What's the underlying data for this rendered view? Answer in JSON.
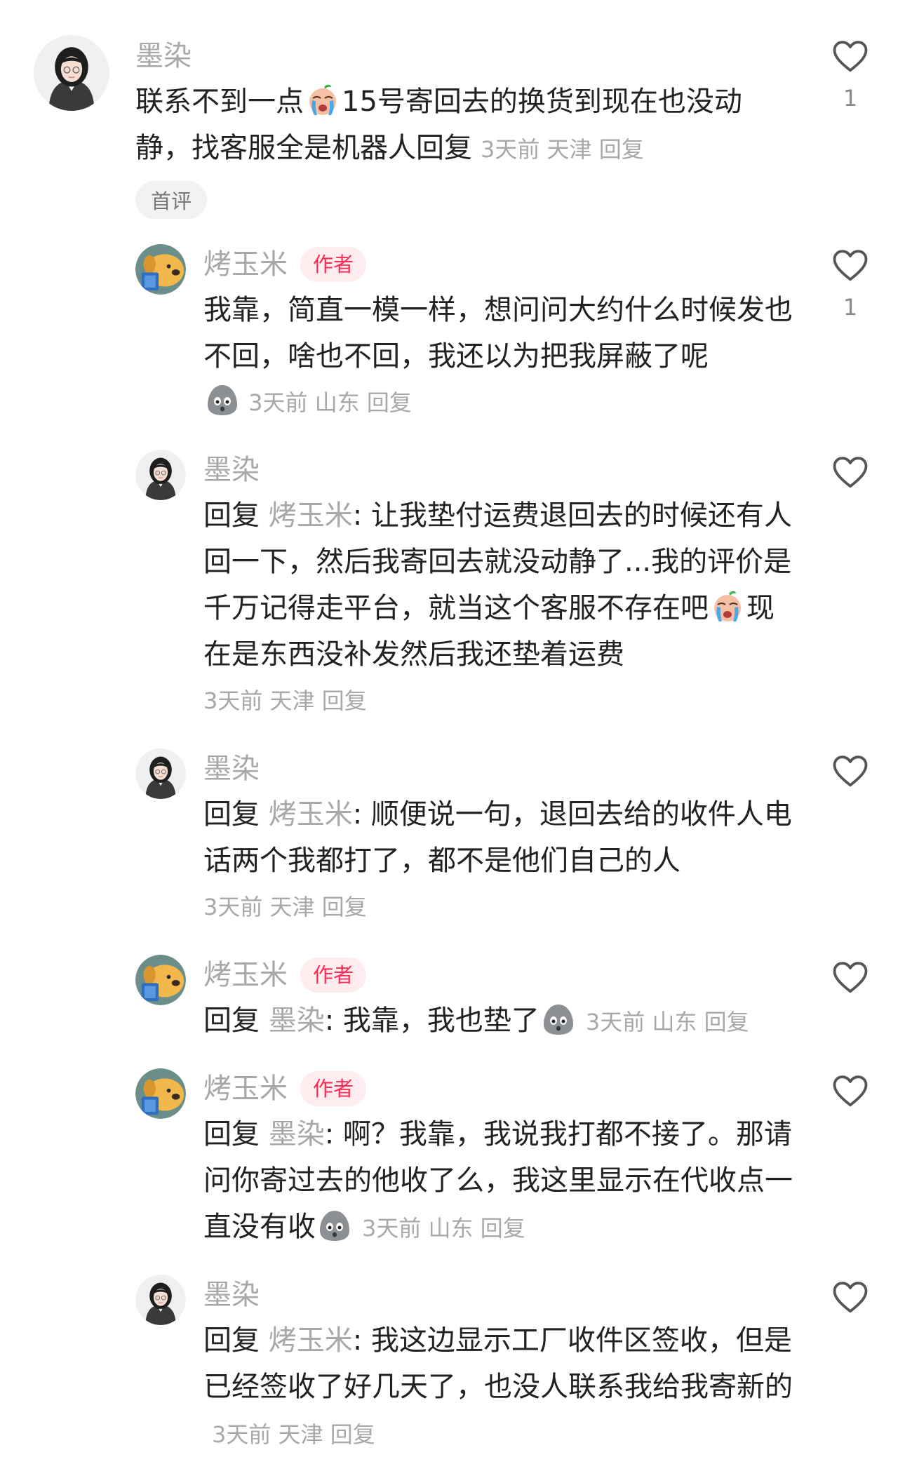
{
  "comments": [
    {
      "user": "墨染",
      "text": "联系不到一点",
      "emoji": "crying-face-emoji",
      "text_after": "15号寄回去的换货到现在也没动静，找客服全是机器人回复",
      "time": "3天前",
      "location": "天津",
      "reply_action": "回复",
      "like_count": "1",
      "tag": "首评"
    },
    {
      "user": "烤玉米",
      "badge": "作者",
      "text": "我靠，简直一模一样，想问问大约什么时候发也不回，啥也不回，我还以为把我屏蔽了呢",
      "emoji": "grey-blob-emoji",
      "time": "3天前",
      "location": "山东",
      "reply_action": "回复",
      "like_count": "1"
    },
    {
      "user": "墨染",
      "reply_prefix": "回复",
      "reply_to": "烤玉米",
      "text": ": 让我垫付运费退回去的时候还有人回一下，然后我寄回去就没动静了...我的评价是千万记得走平台，就当这个客服不存在吧",
      "emoji": "crying-face-emoji",
      "text_after": "现在是东西没补发然后我还垫着运费",
      "time": "3天前",
      "location": "天津",
      "reply_action": "回复"
    },
    {
      "user": "墨染",
      "reply_prefix": "回复",
      "reply_to": "烤玉米",
      "text": ": 顺便说一句，退回去给的收件人电话两个我都打了，都不是他们自己的人",
      "time": "3天前",
      "location": "天津",
      "reply_action": "回复"
    },
    {
      "user": "烤玉米",
      "badge": "作者",
      "reply_prefix": "回复",
      "reply_to": "墨染",
      "text": ": 我靠，我也垫了",
      "emoji": "grey-blob-emoji",
      "time": "3天前",
      "location": "山东",
      "reply_action": "回复"
    },
    {
      "user": "烤玉米",
      "badge": "作者",
      "reply_prefix": "回复",
      "reply_to": "墨染",
      "text": ": 啊？我靠，我说我打都不接了。那请问你寄过去的他收了么，我这里显示在代收点一直没有收",
      "emoji": "grey-blob-emoji",
      "time": "3天前",
      "location": "山东",
      "reply_action": "回复"
    },
    {
      "user": "墨染",
      "reply_prefix": "回复",
      "reply_to": "烤玉米",
      "text": ": 我这边显示工厂收件区签收，但是已经签收了好几天了，也没人联系我给我寄新的",
      "time": "3天前",
      "location": "天津",
      "reply_action": "回复"
    }
  ]
}
